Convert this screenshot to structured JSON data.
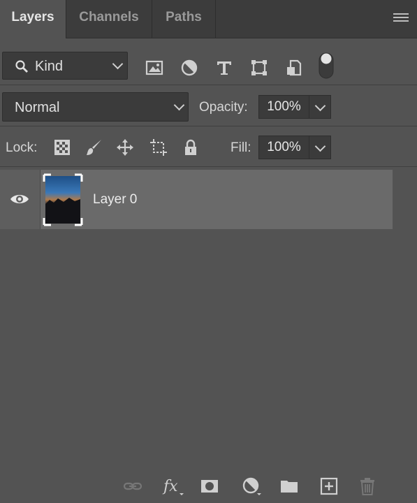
{
  "tabs": [
    {
      "label": "Layers",
      "active": true
    },
    {
      "label": "Channels",
      "active": false
    },
    {
      "label": "Paths",
      "active": false
    }
  ],
  "panel_menu_icon": "hamburger-menu-icon",
  "filter": {
    "kind_label": "Kind",
    "icons": [
      "image-filter-icon",
      "adjustment-filter-icon",
      "type-filter-icon",
      "shape-filter-icon",
      "smart-object-filter-icon",
      "filter-toggle-icon"
    ]
  },
  "blend": {
    "mode": "Normal",
    "opacity_label": "Opacity:",
    "opacity_value": "100%"
  },
  "lock": {
    "label": "Lock:",
    "icons": [
      "lock-transparent-pixels-icon",
      "lock-image-pixels-icon",
      "lock-position-icon",
      "lock-artboard-icon",
      "lock-all-icon"
    ],
    "fill_label": "Fill:",
    "fill_value": "100%"
  },
  "layers": [
    {
      "name": "Layer 0",
      "visible": true,
      "selected": true
    }
  ],
  "bottom_icons": [
    "link-layers-icon",
    "fx-icon",
    "add-mask-icon",
    "adjustment-layer-icon",
    "new-group-icon",
    "new-layer-icon",
    "delete-icon"
  ],
  "colors": {
    "panel_bg": "#535353",
    "tab_bar_bg": "#3c3c3c",
    "field_bg": "#3b3b3b",
    "selected_layer_bg": "#6a6a6a"
  }
}
